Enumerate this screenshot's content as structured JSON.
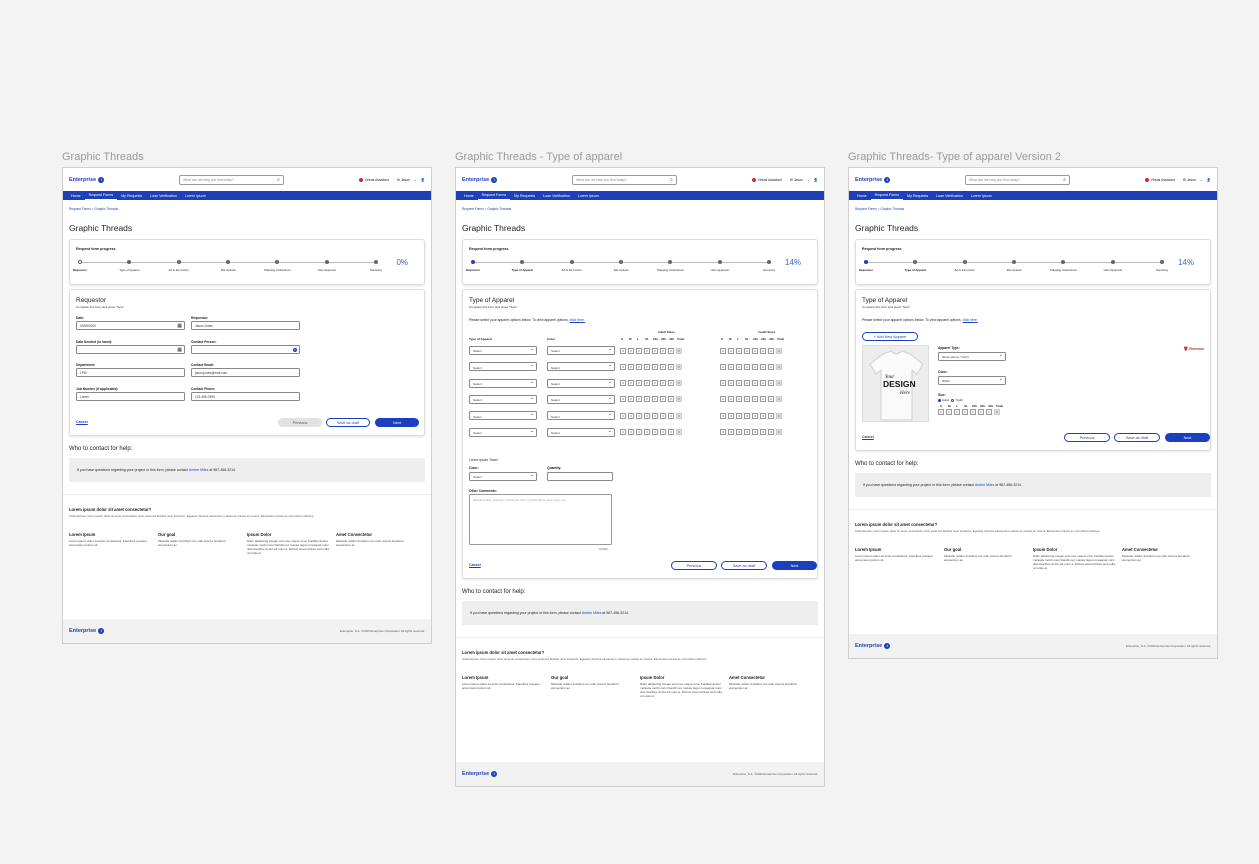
{
  "frames": {
    "f1": {
      "label": "Graphic Threads"
    },
    "f2": {
      "label": "Graphic Threads - Type of apparel"
    },
    "f3": {
      "label": "Graphic Threads- Type of apparel Version 2"
    }
  },
  "header": {
    "brand": "Enterprise",
    "search_placeholder": "What can we help you find today?",
    "virtual_assistant": "Virtual Assistant",
    "user": "Hi Jason"
  },
  "nav": [
    "Home",
    "Request Forms",
    "My Requests",
    "Loan Verification",
    "Lorem Ipsum"
  ],
  "breadcrumb": "Request Forms  >  Graphic Threads",
  "page_title": "Graphic Threads",
  "progress": {
    "title": "Request form progress",
    "steps": [
      "Requestor",
      "Type of Apparel",
      "Art & Ink Colors",
      "File Upload",
      "Shipping Instructions",
      "User Approval",
      "Summary"
    ],
    "pct_f1": "0%",
    "pct_f2": "14%",
    "pct_f3": "14%",
    "value_f1": 0,
    "value_f2": 14,
    "value_f3": 14
  },
  "requestor_form": {
    "title": "Requestor",
    "subtitle": "Complete this form and press \"Next\"",
    "date_label": "Date:",
    "date_value": "03/05/2020",
    "requestor_label": "Requestor:",
    "requestor_value": "Jason Jones",
    "date_needed_label": "Date Needed (in hand):",
    "contact_person_label": "Contact Person:",
    "department_label": "Department:",
    "department_value": "LPM",
    "contact_email_label": "Contact Email:",
    "contact_email_value": "jason.jones@ents.com",
    "job_label": "Job Number (if applicable):",
    "job_value": "Lorem",
    "phone_label": "Contact Phone:",
    "phone_value": "123-456-7890"
  },
  "buttons": {
    "cancel": "Cancel",
    "previous": "Previous",
    "save_draft": "Save as draft",
    "next": "Next"
  },
  "apparel_form": {
    "title": "Type of Apparel",
    "subtitle": "Complete this form and press \"Next\"",
    "instruction": "Please select your apparel options below. To view apparel options,",
    "click_here": "click here.",
    "col_type": "Type of Apparel",
    "col_color": "Color",
    "adult_sizes": "Adult Sizes",
    "youth_sizes": "Youth Sizes",
    "sizes": [
      "S",
      "M",
      "L",
      "XL",
      "2XL",
      "3XL",
      "4XL",
      "Total"
    ],
    "select": "Select",
    "zero": "0",
    "towel_label": "Lorem Ipsum Towel",
    "color_label": "Color:",
    "quantity_label": "Quantity:",
    "other_comments": "Other Comments:",
    "comments_placeholder": "Specify colors, quantity, t-shirts per size, specific items, Eco Logo, etc.",
    "char_count": "0/1000"
  },
  "apparel_v2": {
    "add_new": "+ Add New Apparel",
    "apparel_type_label": "Apparel Type:",
    "apparel_type_value": "Short-sleeve T-shirt",
    "remove": "Remove",
    "color_label": "Color:",
    "color_value": "White",
    "size_label": "Size:",
    "adult": "Adult",
    "youth": "Youth",
    "size_cols": [
      "S",
      "M",
      "L",
      "XL",
      "2XL",
      "3XL",
      "4XL",
      "Total"
    ],
    "tshirt_text_1": "Your",
    "tshirt_text_2": "DESIGN",
    "tshirt_text_3": "Here"
  },
  "help": {
    "title": "Who to contact for help:",
    "text_before": "If you have questions regarding your project or this form, please contact",
    "contact": "Amber Miles",
    "text_after": "at 987-456-3214."
  },
  "footer": {
    "heading": "Lorem ipsum dolor sit amet consectetur?",
    "sub": "At Enterprise, lorem ipsum dolor sit amet consectetur. Arcu euismod facilisis nunc interdum. Egestas rhoncus elementum massa ac massa ac viverra. Elementum luctus ac enim libero ultricies.",
    "cols": [
      {
        "title": "Lorem Ipsum",
        "text": "Lorem ipsum dolor sit amet consectetur. Faucibus posuere accumsan pretium sit."
      },
      {
        "title": "Our goal",
        "text": "Molestie nullam tincidunt nec odio viverra hendrerit elementum ac."
      },
      {
        "title": "Ipsum Dolor",
        "text": "Diam adipiscing integer enim leo neque urna. Facilisis auctor molestie morbi nunc blandit nec massa. Eget consequat nunc duis faucibus at dui elit nunc a. Dictum amet ultrices sed nulla ut turpis et."
      },
      {
        "title": "Amet Consectetur",
        "text": "Molestie nullam tincidunt nec odio viverra hendrerit elementum ac."
      }
    ],
    "copyright": "Enterprise, N.A. ©2023 Enterprise Corporation. All rights reserved."
  }
}
